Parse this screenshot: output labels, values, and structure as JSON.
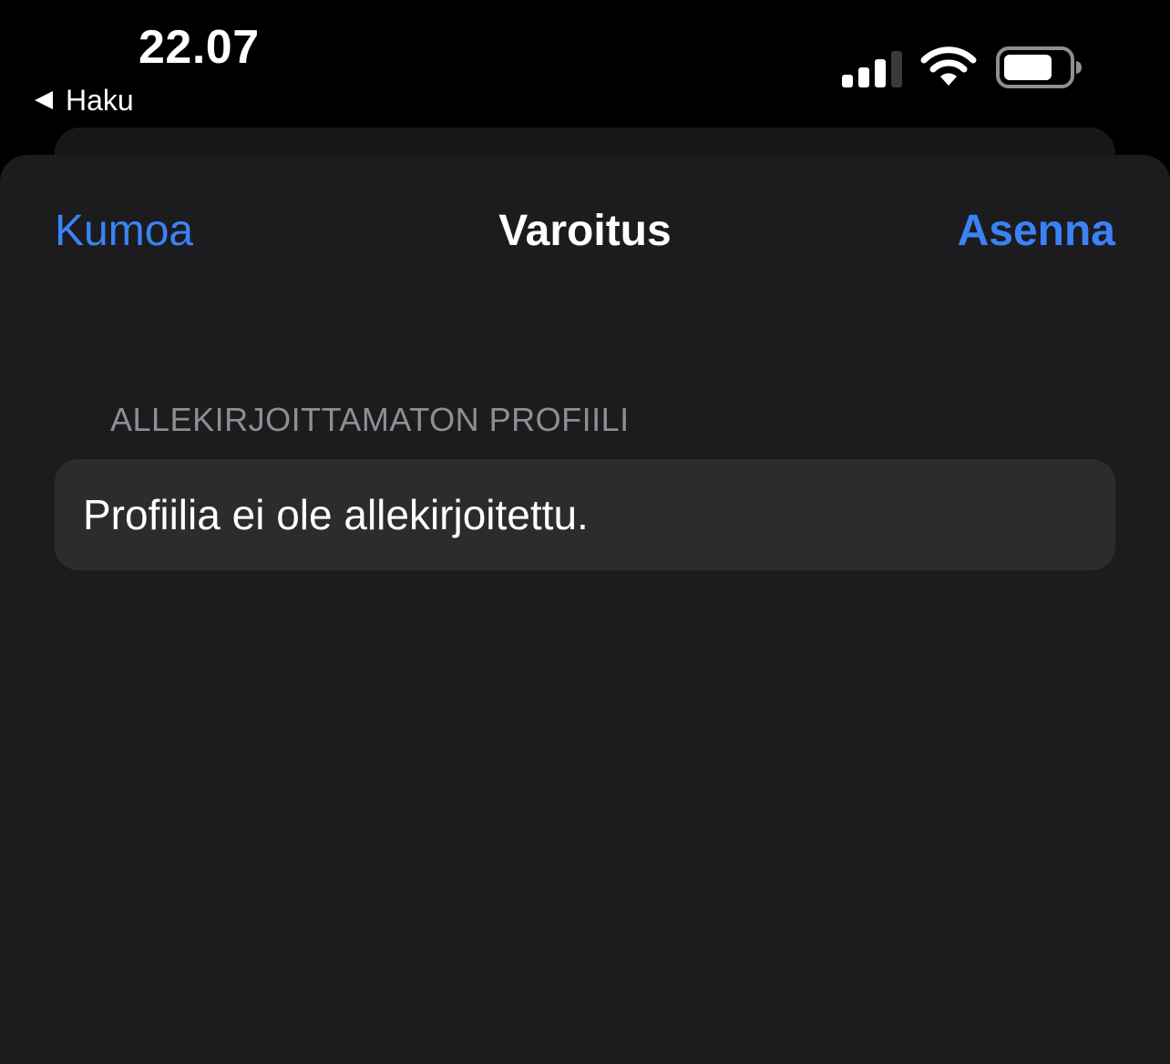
{
  "status_bar": {
    "time": "22.07",
    "back_label": "Haku",
    "icons": [
      "signal-icon",
      "wifi-icon",
      "battery-icon"
    ]
  },
  "nav": {
    "cancel_label": "Kumoa",
    "title": "Varoitus",
    "install_label": "Asenna"
  },
  "section": {
    "header": "ALLEKIRJOITTAMATON PROFIILI",
    "message": "Profiilia ei ole allekirjoitettu."
  },
  "colors": {
    "accent": "#3b82f6",
    "sheet_background": "#1c1c1e",
    "card_background": "#2c2c2e",
    "section_header": "#8e8e93"
  }
}
